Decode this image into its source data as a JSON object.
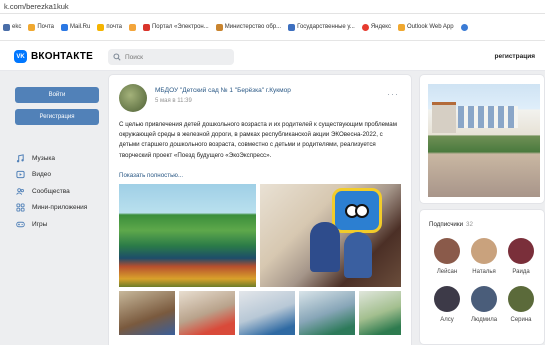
{
  "browser": {
    "url": "k.com/berezka1kuk",
    "bookmarks": [
      {
        "label": "ekc",
        "color": "#4a6ea8"
      },
      {
        "label": "Почта",
        "color": "#f0a830"
      },
      {
        "label": "Mail.Ru",
        "color": "#2b78e4"
      },
      {
        "label": "почта",
        "color": "#f5b400"
      },
      {
        "label": "",
        "color": "#f3a53b"
      },
      {
        "label": "Портал «Электрон...",
        "color": "#d9342b"
      },
      {
        "label": "Министерство обр...",
        "color": "#c9842e"
      },
      {
        "label": "Государственные у...",
        "color": "#3d6fbf"
      },
      {
        "label": "Яндекс",
        "color": "#e63b2e"
      },
      {
        "label": "Outlook Web App",
        "color": "#f0a830"
      },
      {
        "label": "",
        "color": "#3a7bd5"
      }
    ]
  },
  "header": {
    "logo_mark": "VK",
    "logo_text": "ВКОНТАКТЕ",
    "search_placeholder": "Поиск",
    "register_link": "регистрация"
  },
  "sidebar": {
    "login_button": "Войти",
    "register_button": "Регистрация",
    "items": [
      {
        "label": "Музыка",
        "icon": "music-icon"
      },
      {
        "label": "Видео",
        "icon": "video-icon"
      },
      {
        "label": "Сообщества",
        "icon": "communities-icon"
      },
      {
        "label": "Мини-приложения",
        "icon": "apps-icon"
      },
      {
        "label": "Игры",
        "icon": "games-icon"
      }
    ]
  },
  "post": {
    "group_name": "МБДОУ \"Детский сад № 1 \"Берёзка\" г.Кукмор",
    "date": "5 мая в 11:39",
    "text": "С целью привлечения детей дошкольного возраста и их родителей к существующим проблемам окружающей среды в железной дороги, в рамках республиканской акции ЭКОвесна-2022, с детьми старшего дошкольного возраста, совместно с детьми и родителями, реализуется творческий проект «Поезд будущего «ЭкоЭкспресс».",
    "show_more": "Показать полностью..."
  },
  "subscribers": {
    "title": "Подписчики",
    "count": "32",
    "people": [
      {
        "name": "Лейсан",
        "color": "#8a5a4a"
      },
      {
        "name": "Наталья",
        "color": "#c9a27d"
      },
      {
        "name": "Раида",
        "color": "#7a2f3a"
      },
      {
        "name": "Алсу",
        "color": "#3d3a48"
      },
      {
        "name": "Людмила",
        "color": "#4a5d7a"
      },
      {
        "name": "Серина",
        "color": "#5b6a3a"
      }
    ]
  }
}
